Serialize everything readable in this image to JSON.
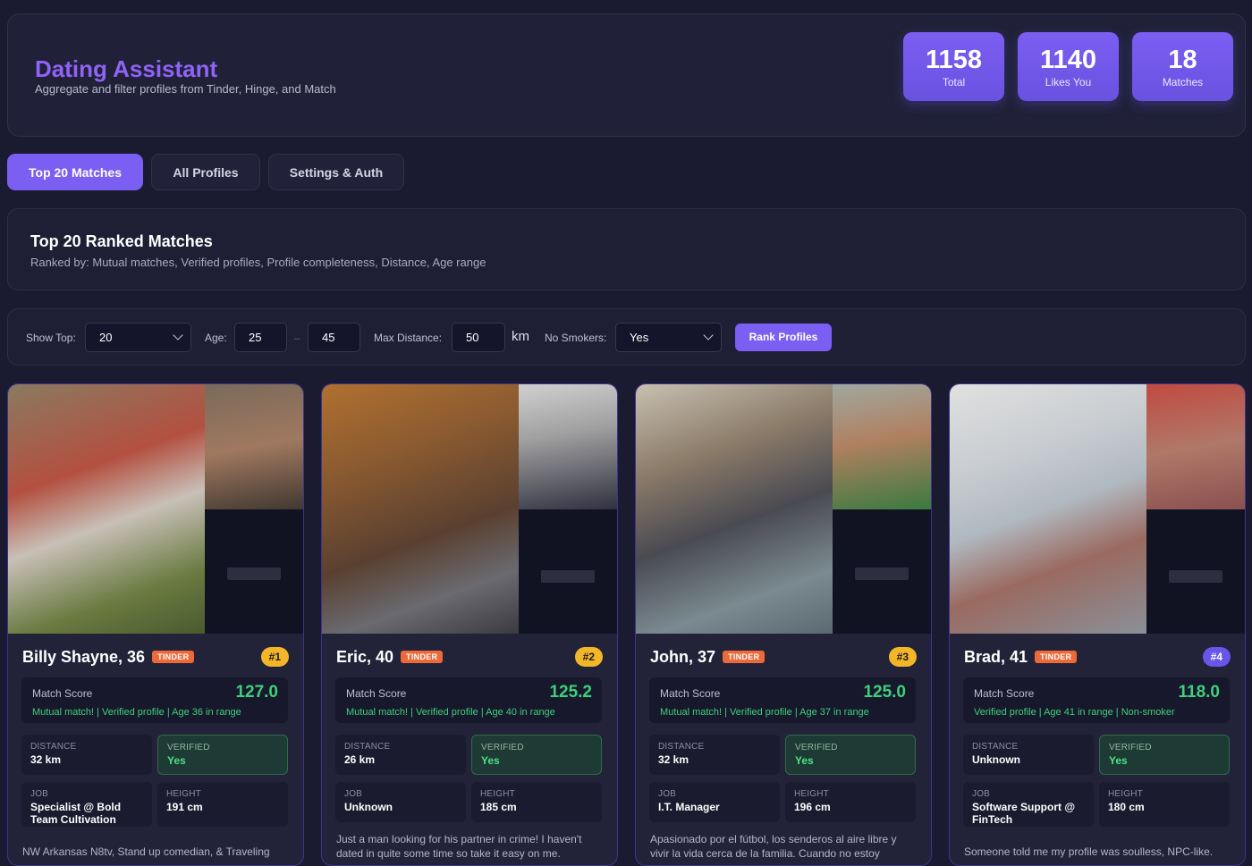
{
  "header": {
    "title": "Dating Assistant",
    "subtitle": "Aggregate and filter profiles from Tinder, Hinge, and Match",
    "stats": [
      {
        "value": "1158",
        "label": "Total"
      },
      {
        "value": "1140",
        "label": "Likes You"
      },
      {
        "value": "18",
        "label": "Matches"
      }
    ]
  },
  "tabs": [
    {
      "label": "Top 20 Matches",
      "active": true
    },
    {
      "label": "All Profiles",
      "active": false
    },
    {
      "label": "Settings & Auth",
      "active": false
    }
  ],
  "ranking": {
    "title": "Top 20 Ranked Matches",
    "description": "Ranked by: Mutual matches, Verified profiles, Profile completeness, Distance, Age range"
  },
  "filters": {
    "show_top_label": "Show Top:",
    "show_top_value": "20",
    "age_label": "Age:",
    "age_min": "25",
    "age_sep": "–",
    "age_max": "45",
    "max_distance_label": "Max Distance:",
    "max_distance_value": "50",
    "distance_unit": "km",
    "no_smokers_label": "No Smokers:",
    "no_smokers_value": "Yes",
    "rank_button": "Rank Profiles"
  },
  "labels": {
    "match_score": "Match Score",
    "distance": "Distance",
    "verified": "Verified",
    "job": "Job",
    "height": "Height"
  },
  "profiles": [
    {
      "name": "Billy Shayne, 36",
      "platform": "TINDER",
      "rank": "#1",
      "score": "127.0",
      "reasons": "Mutual match! | Verified profile | Age 36 in range",
      "distance": "32 km",
      "verified": "Yes",
      "job": "Specialist @ Bold Team Cultivation",
      "height": "191 cm",
      "bio": "NW Arkansas N8tv, Stand up comedian, & Traveling"
    },
    {
      "name": "Eric, 40",
      "platform": "TINDER",
      "rank": "#2",
      "score": "125.2",
      "reasons": "Mutual match! | Verified profile | Age 40 in range",
      "distance": "26 km",
      "verified": "Yes",
      "job": "Unknown",
      "height": "185 cm",
      "bio": "Just a man looking for his partner in crime! I haven't dated in quite some time so take it easy on me."
    },
    {
      "name": "John, 37",
      "platform": "TINDER",
      "rank": "#3",
      "score": "125.0",
      "reasons": "Mutual match! | Verified profile | Age 37 in range",
      "distance": "32 km",
      "verified": "Yes",
      "job": "I.T. Manager",
      "height": "196 cm",
      "bio": "Apasionado por el fútbol, los senderos al aire libre y vivir la vida cerca de la familia. Cuando no estoy"
    },
    {
      "name": "Brad, 41",
      "platform": "TINDER",
      "rank": "#4",
      "score": "118.0",
      "reasons": "Verified profile | Age 41 in range | Non-smoker",
      "distance": "Unknown",
      "verified": "Yes",
      "job": "Software Support @ FinTech",
      "height": "180 cm",
      "bio": "Someone told me my profile was soulless, NPC-like."
    }
  ]
}
